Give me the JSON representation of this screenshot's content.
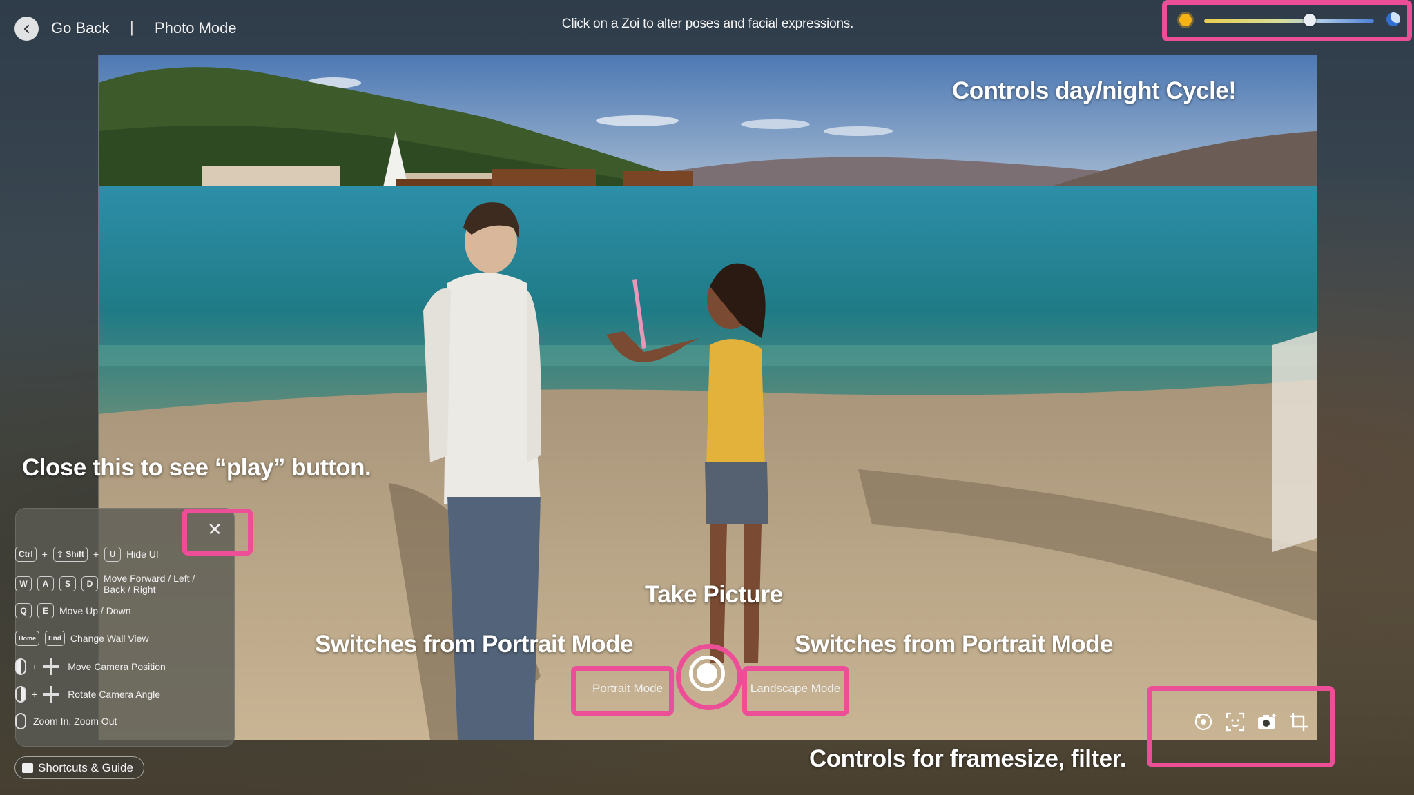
{
  "header": {
    "back_label": "Go Back",
    "separator": "|",
    "title": "Photo Mode",
    "instruction": "Click on a Zoi to alter poses and facial expressions."
  },
  "day_night_slider": {
    "value": 0.62
  },
  "annotations": {
    "daynight": "Controls day/night Cycle!",
    "close_hint": "Close this to see “play” button.",
    "take_picture": "Take Picture",
    "switch_left": "Switches from Portrait Mode",
    "switch_right": "Switches from Portrait Mode",
    "frame_filter": "Controls for framesize, filter."
  },
  "shortcuts": {
    "close_label": "✕",
    "rows": [
      {
        "keys": [
          "Ctrl",
          "⇧ Shift",
          "U"
        ],
        "label": "Hide UI"
      },
      {
        "keys": [
          "W",
          "A",
          "S",
          "D"
        ],
        "label": "Move Forward / Left / Back / Right"
      },
      {
        "keys": [
          "Q",
          "E"
        ],
        "label": "Move Up / Down"
      },
      {
        "keys": [
          "Home",
          "End"
        ],
        "label": "Change Wall View"
      },
      {
        "label": "Move Camera Position"
      },
      {
        "label": "Rotate Camera Angle"
      },
      {
        "label": "Zoom In, Zoom Out"
      }
    ],
    "guide_label": "Shortcuts & Guide"
  },
  "bottom_bar": {
    "portrait_label": "Portrait Mode",
    "landscape_label": "Landscape Mode"
  },
  "colors": {
    "highlight": "#ec4f97",
    "sun": "#f5b316",
    "moon": "#2f6fd1"
  },
  "icons": [
    "back-chevron-icon",
    "sun-icon",
    "moon-icon",
    "close-icon",
    "mouse-icon",
    "move-arrows-icon",
    "scroll-icon",
    "book-icon",
    "rotate-camera-icon",
    "face-focus-icon",
    "camera-filter-icon",
    "crop-icon"
  ]
}
